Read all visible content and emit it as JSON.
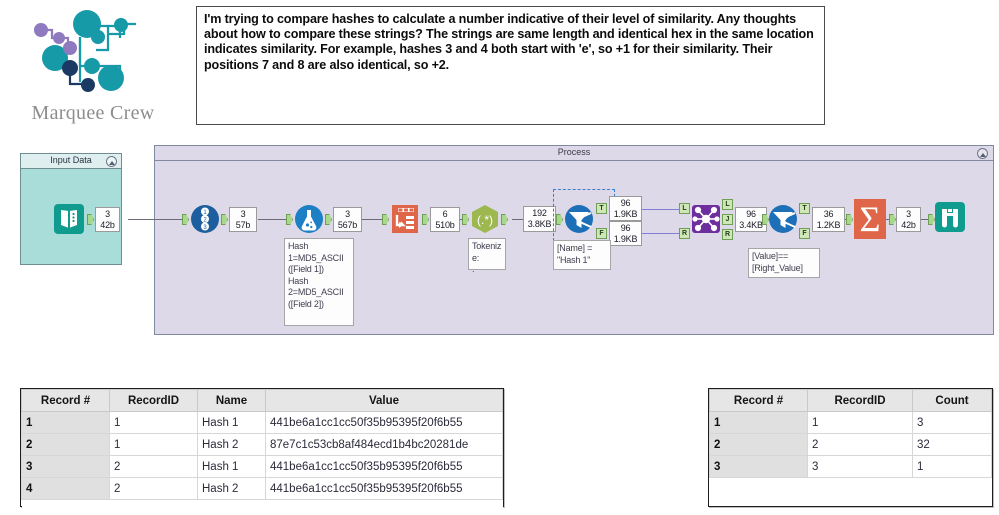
{
  "brand": {
    "name": "Marquee Crew",
    "colors": {
      "teal": "#169aa8",
      "purple": "#8f7ac0",
      "navy": "#1b3a63",
      "text": "#8d8d90"
    }
  },
  "question": {
    "text": "I'm trying to compare hashes to calculate a number indicative of their level of similarity. Any thoughts about how to compare these strings? The strings are same length and identical hex in the same location indicates similarity. For example, hashes 3 and 4 both start with 'e', so +1 for their similarity. Their positions 7 and 8 are also identical, so +2."
  },
  "canvas": {
    "input_container": {
      "title": "Input Data"
    },
    "process_container": {
      "title": "Process"
    },
    "tools": [
      {
        "id": "input-data",
        "icon": "book-icon",
        "count": "3",
        "size": "42b"
      },
      {
        "id": "record-id",
        "icon": "numbered-list-icon",
        "count": "3",
        "size": "57b"
      },
      {
        "id": "formula",
        "icon": "flask-icon",
        "count": "3",
        "size": "567b"
      },
      {
        "id": "transpose",
        "icon": "transpose-icon",
        "count": "6",
        "size": "510b"
      },
      {
        "id": "regex",
        "icon": "regex-icon",
        "count": "192",
        "size": "3.8KB"
      },
      {
        "id": "filter",
        "icon": "filter-funnel-icon",
        "count_true": "96",
        "size_true": "1.9KB",
        "count_false": "96",
        "size_false": "1.9KB"
      },
      {
        "id": "join",
        "icon": "join-network-icon",
        "count": "96",
        "size": "3.4KB"
      },
      {
        "id": "filter-2",
        "icon": "filter-funnel-icon",
        "count": "36",
        "size": "1.2KB"
      },
      {
        "id": "summarize",
        "icon": "sigma-icon",
        "count": "3",
        "size": "42b"
      },
      {
        "id": "browse",
        "icon": "binoculars-icon"
      }
    ],
    "annotations": {
      "formula": "Hash 1=MD5_ASCII([Field 1])\nHash 2=MD5_ASCII([Field 2])",
      "formula_lines": [
        "Hash",
        "1=MD5_ASCII",
        "([Field 1])",
        "Hash",
        "2=MD5_ASCII",
        "([Field 2])"
      ],
      "regex": "Tokenize:",
      "regex_line2": ".",
      "filter": "[Name] = \"Hash 1\"",
      "filter2": "[Value]==[Right_Value]"
    },
    "port_labels": {
      "true": "T",
      "false": "F",
      "left": "L",
      "join": "J",
      "right": "R"
    }
  },
  "results_left": {
    "columns": [
      "Record #",
      "RecordID",
      "Name",
      "Value"
    ],
    "rows": [
      [
        "1",
        "1",
        "Hash 1",
        "441be6a1cc1cc50f35b95395f20f6b55"
      ],
      [
        "2",
        "1",
        "Hash 2",
        "87e7c1c53cb8af484ecd1b4bc20281de"
      ],
      [
        "3",
        "2",
        "Hash 1",
        "441be6a1cc1cc50f35b95395f20f6b55"
      ],
      [
        "4",
        "2",
        "Hash 2",
        "441be6a1cc1cc50f35b95395f20f6b55"
      ]
    ]
  },
  "results_right": {
    "columns": [
      "Record #",
      "RecordID",
      "Count"
    ],
    "rows": [
      [
        "1",
        "1",
        "3"
      ],
      [
        "2",
        "2",
        "32"
      ],
      [
        "3",
        "3",
        "1"
      ]
    ]
  }
}
